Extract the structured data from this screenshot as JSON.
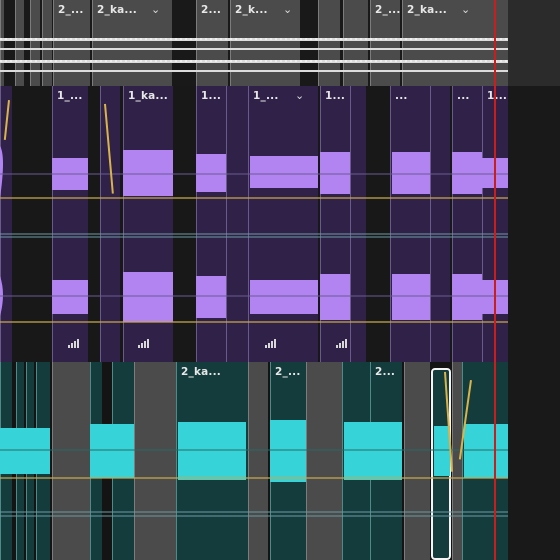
{
  "colors": {
    "background": "#191919",
    "gray_track": "#4b4b4b",
    "purple_track": "#2f2147",
    "purple_wave": "#b184f2",
    "teal_track": "#153c3c",
    "teal_wave": "#36d4d8",
    "playhead": "#c81e1e",
    "volume_line": "#d9b44a"
  },
  "tracks": {
    "top": {
      "clips": [
        {
          "label": ""
        },
        {
          "label": ""
        },
        {
          "label": ""
        },
        {
          "label": ""
        },
        {
          "label": "2_..."
        },
        {
          "label": "2_ka..."
        },
        {
          "label": "2..."
        },
        {
          "label": "2_k..."
        },
        {
          "label": ""
        },
        {
          "label": ""
        },
        {
          "label": "2_..."
        },
        {
          "label": "2_ka..."
        }
      ]
    },
    "middle": {
      "clips": [
        {
          "label": ""
        },
        {
          "label": "1_..."
        },
        {
          "label": ""
        },
        {
          "label": "1_ka..."
        },
        {
          "label": "1..."
        },
        {
          "label": ""
        },
        {
          "label": "1_..."
        },
        {
          "label": "1..."
        },
        {
          "label": ""
        },
        {
          "label": "..."
        },
        {
          "label": ""
        },
        {
          "label": "..."
        },
        {
          "label": "1..."
        }
      ]
    },
    "bottom": {
      "clips": [
        {
          "label": ""
        },
        {
          "label": ""
        },
        {
          "label": ""
        },
        {
          "label": ""
        },
        {
          "label": ""
        },
        {
          "label": ""
        },
        {
          "label": "2_ka..."
        },
        {
          "label": ""
        },
        {
          "label": "2_..."
        },
        {
          "label": ""
        },
        {
          "label": "2..."
        },
        {
          "label": ""
        },
        {
          "label": ""
        },
        {
          "label": ""
        }
      ]
    }
  },
  "icons": {
    "clip_menu": "chevron-down-icon",
    "clip_effects": "audio-bars-icon"
  }
}
